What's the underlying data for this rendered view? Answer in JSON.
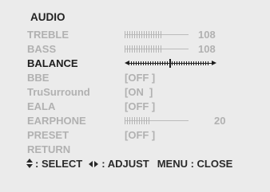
{
  "menu": {
    "title": "AUDIO",
    "items": [
      {
        "label": "TREBLE",
        "type": "slider",
        "value": "108",
        "level": 0.6
      },
      {
        "label": "BASS",
        "type": "slider",
        "value": "108",
        "level": 0.6
      },
      {
        "label": "BALANCE",
        "type": "balance",
        "active": true
      },
      {
        "label": "BBE",
        "type": "option",
        "value": "[OFF ]"
      },
      {
        "label": "TruSurround",
        "type": "option",
        "value": "[ON  ]"
      },
      {
        "label": "EALA",
        "type": "option",
        "value": "[OFF ]"
      },
      {
        "label": "EARPHONE",
        "type": "slider",
        "value": "20",
        "level": 0.4
      },
      {
        "label": "PRESET",
        "type": "option",
        "value": "[OFF ]"
      },
      {
        "label": "RETURN",
        "type": "none"
      }
    ]
  },
  "footer": {
    "select": ": SELECT",
    "adjust": ": ADJUST",
    "menu_close": "MENU : CLOSE"
  },
  "colors": {
    "background": "#ebebeb",
    "active": "#1e1e1e",
    "inactive": "#b1b1b1"
  },
  "icons": {
    "select": "up-down-arrows-icon",
    "adjust": "left-right-arrows-icon"
  }
}
